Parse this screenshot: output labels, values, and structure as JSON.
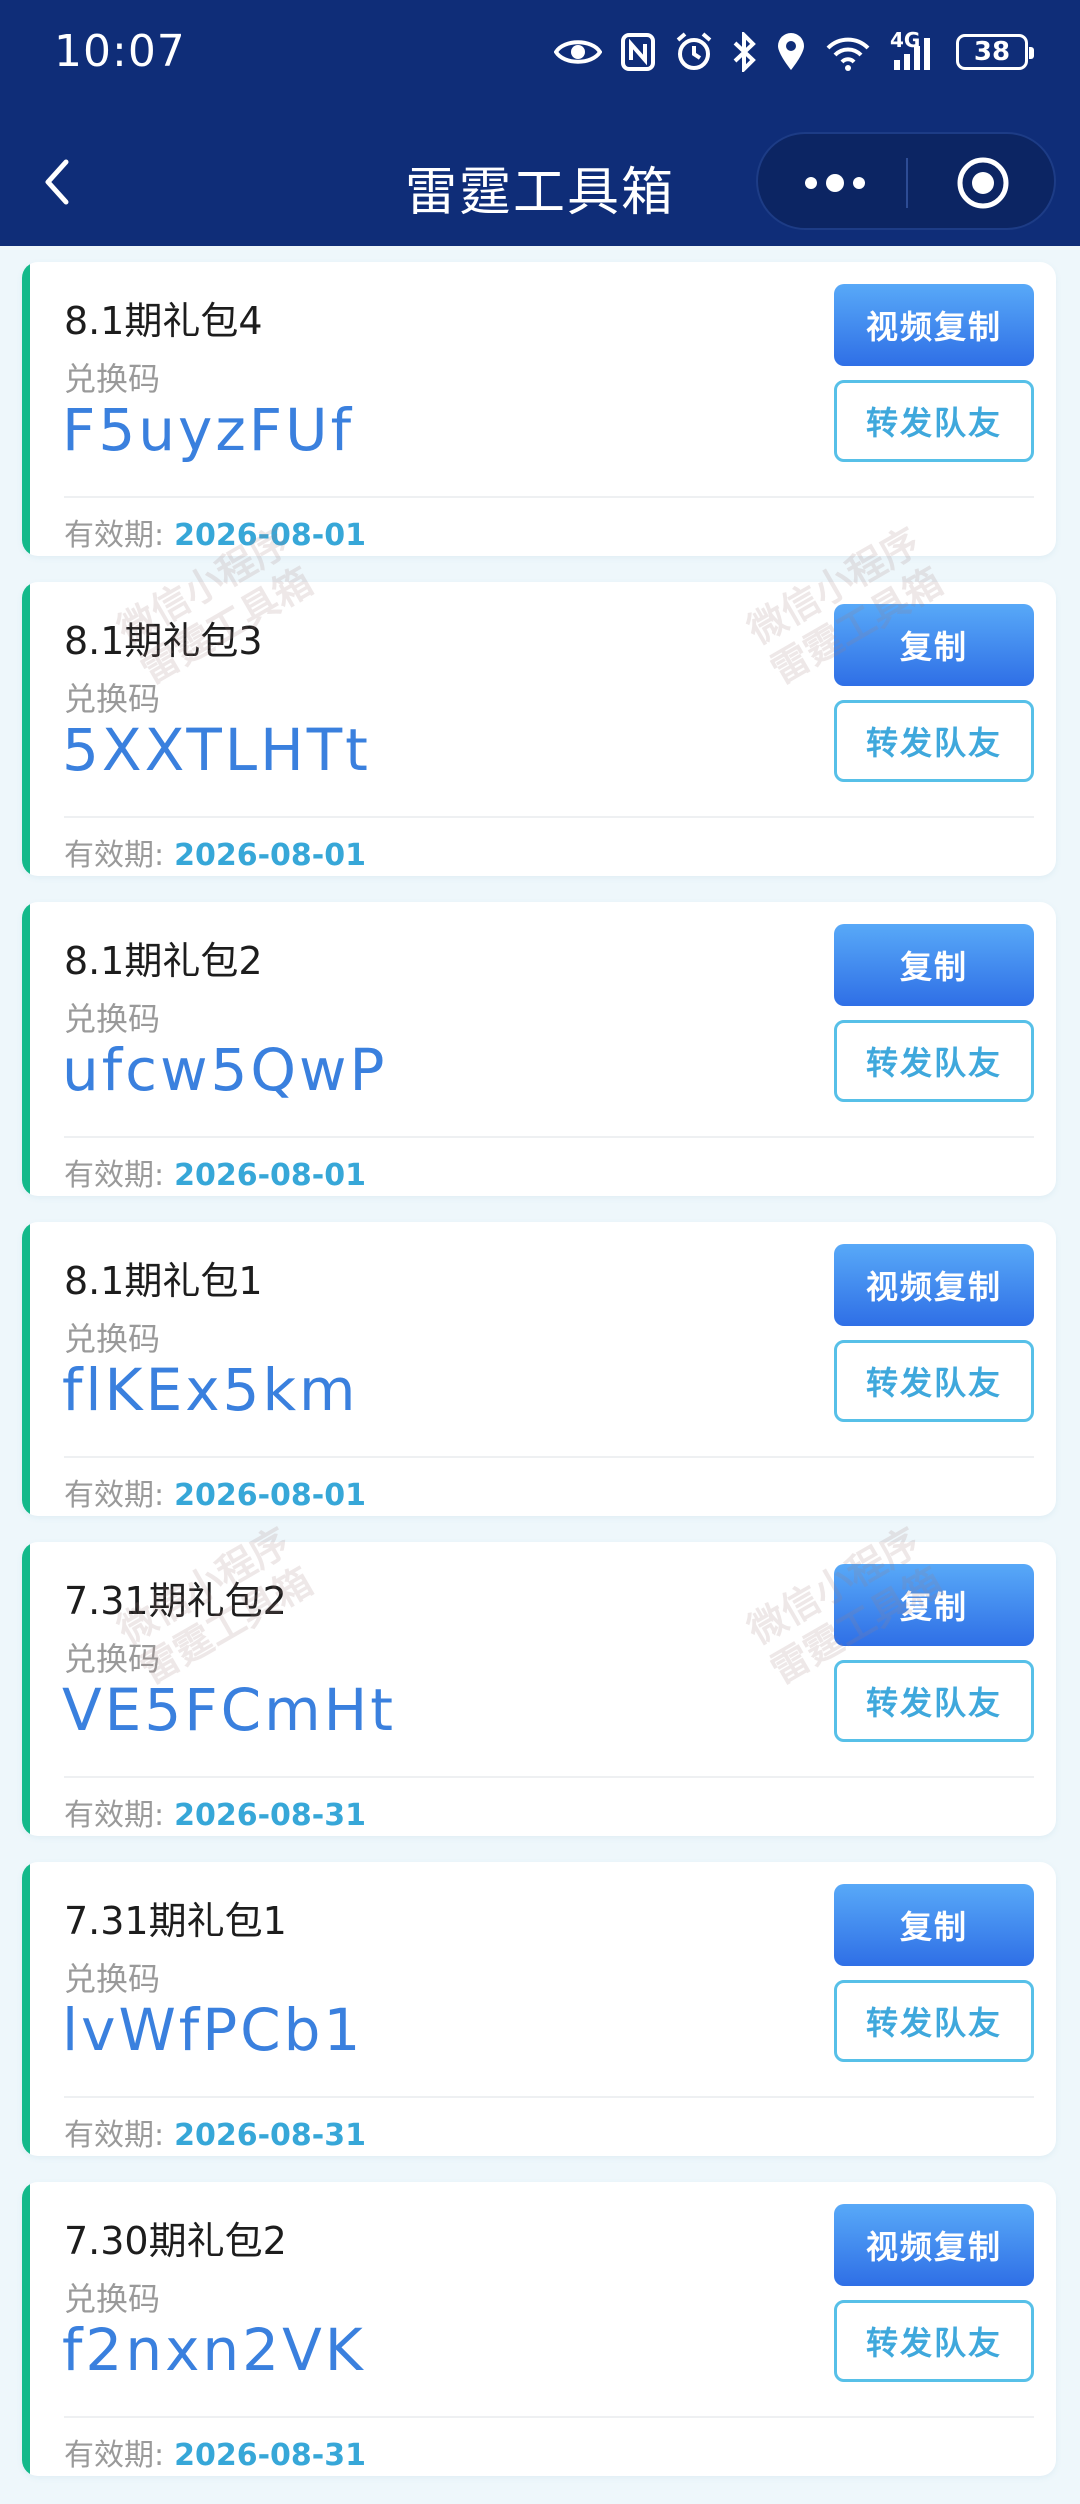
{
  "status_bar": {
    "time": "10:07",
    "network": "4G",
    "battery": "38"
  },
  "nav": {
    "title": "雷霆工具箱"
  },
  "labels": {
    "code_label": "兑换码",
    "expiry_label": "有效期:",
    "share_button": "转发队友"
  },
  "watermark": {
    "line1": "微信小程序",
    "line2": "雷霆工具箱"
  },
  "cards": [
    {
      "title": "8.1期礼包4",
      "code": "F5uyzFUf",
      "expiry": "2026-08-01",
      "copy_label": "视频复制"
    },
    {
      "title": "8.1期礼包3",
      "code": "5XXTLHTt",
      "expiry": "2026-08-01",
      "copy_label": "复制"
    },
    {
      "title": "8.1期礼包2",
      "code": "ufcw5QwP",
      "expiry": "2026-08-01",
      "copy_label": "复制"
    },
    {
      "title": "8.1期礼包1",
      "code": "flKEx5km",
      "expiry": "2026-08-01",
      "copy_label": "视频复制"
    },
    {
      "title": "7.31期礼包2",
      "code": "VE5FCmHt",
      "expiry": "2026-08-31",
      "copy_label": "复制"
    },
    {
      "title": "7.31期礼包1",
      "code": "lvWfPCb1",
      "expiry": "2026-08-31",
      "copy_label": "复制"
    },
    {
      "title": "7.30期礼包2",
      "code": "f2nxn2VK",
      "expiry": "2026-08-31",
      "copy_label": "视频复制"
    }
  ],
  "colors": {
    "header_bg": "#0f2d78",
    "accent_bar": "#14b98a",
    "code_blue": "#3a80de",
    "expiry_blue": "#37a7d8",
    "share_border": "#57c0e8"
  },
  "icons": [
    "back-arrow-icon",
    "eye-icon",
    "nfc-icon",
    "alarm-icon",
    "bluetooth-icon",
    "location-icon",
    "wifi-icon",
    "signal-icon",
    "battery-icon",
    "more-dots-icon",
    "target-icon"
  ]
}
